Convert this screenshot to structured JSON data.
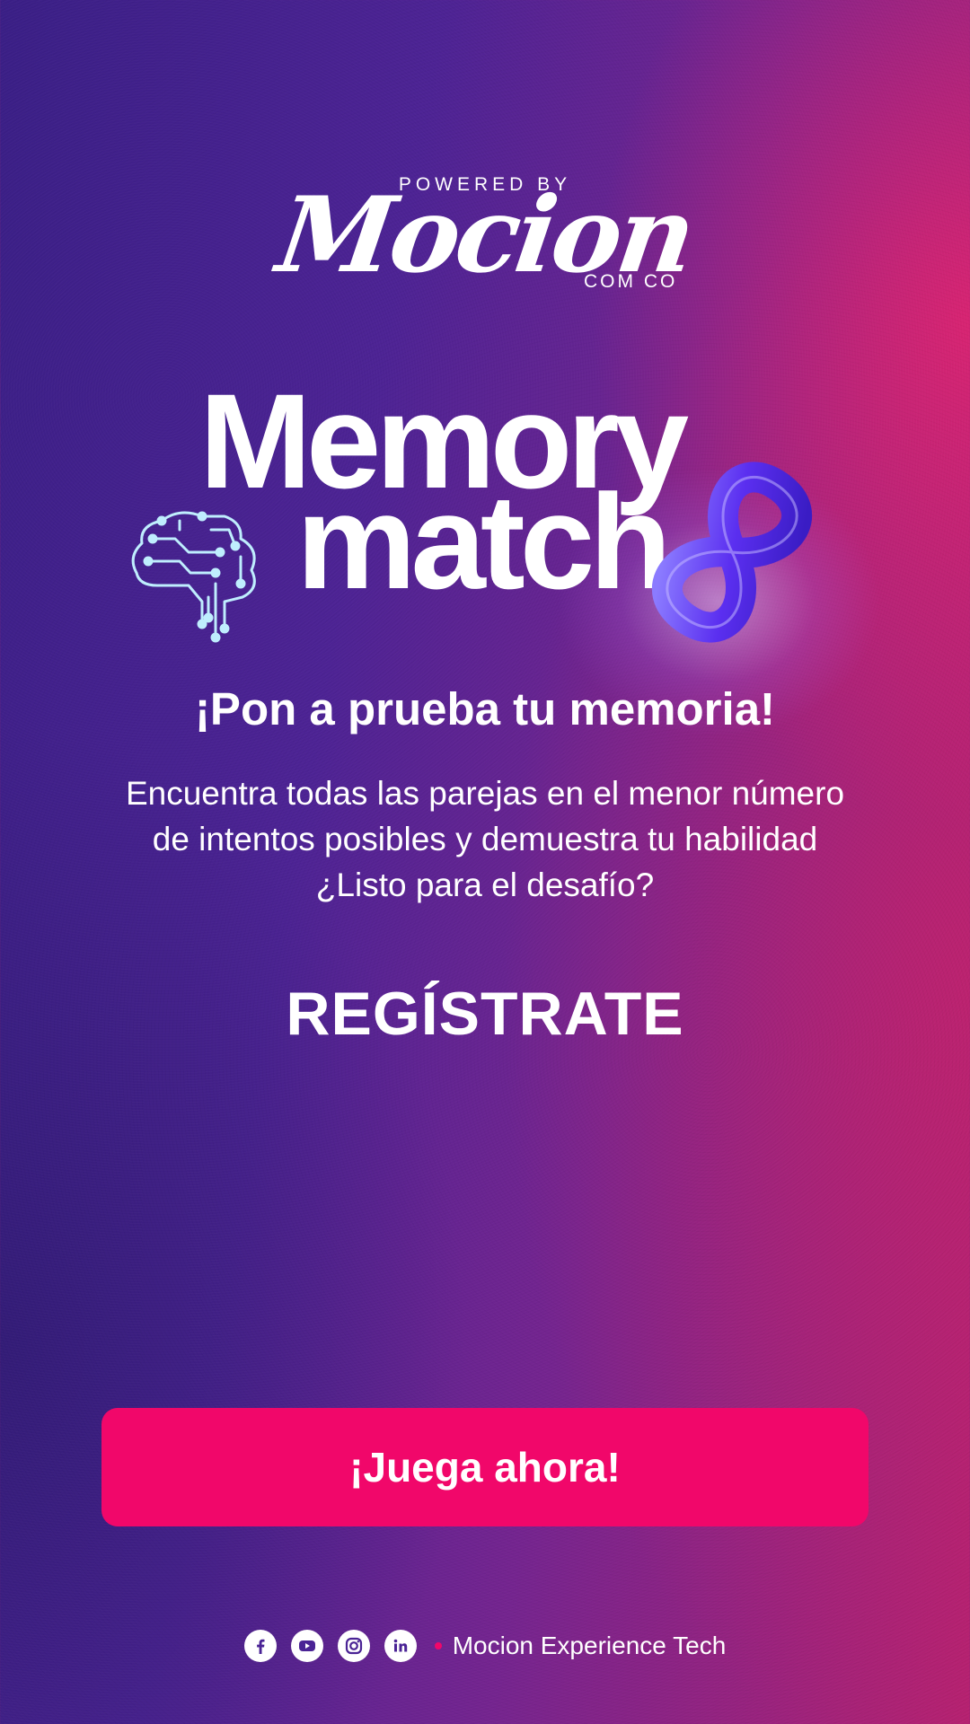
{
  "brand": {
    "powered_by": "POWERED BY",
    "name": "Mocion",
    "suffix": "COM CO"
  },
  "logo": {
    "line1": "Memory",
    "line2": "match",
    "icons": [
      "brain-circuit-icon",
      "infinity-icon"
    ]
  },
  "hero": {
    "tagline": "¡Pon a prueba tu memoria!",
    "description": "Encuentra todas las parejas en el menor número de intentos posibles y demuestra tu habilidad ¿Listo para el desafío?",
    "register_heading": "REGÍSTRATE"
  },
  "cta": {
    "play_label": "¡Juega ahora!"
  },
  "footer": {
    "social": [
      "facebook-icon",
      "youtube-icon",
      "instagram-icon",
      "linkedin-icon"
    ],
    "company": "Mocion Experience Tech"
  },
  "colors": {
    "button": "#f1076a",
    "background_left": "#3a1f86",
    "background_right": "#b52170",
    "infinity": "#6a3df0",
    "brain_outline": "#bfeefe"
  }
}
